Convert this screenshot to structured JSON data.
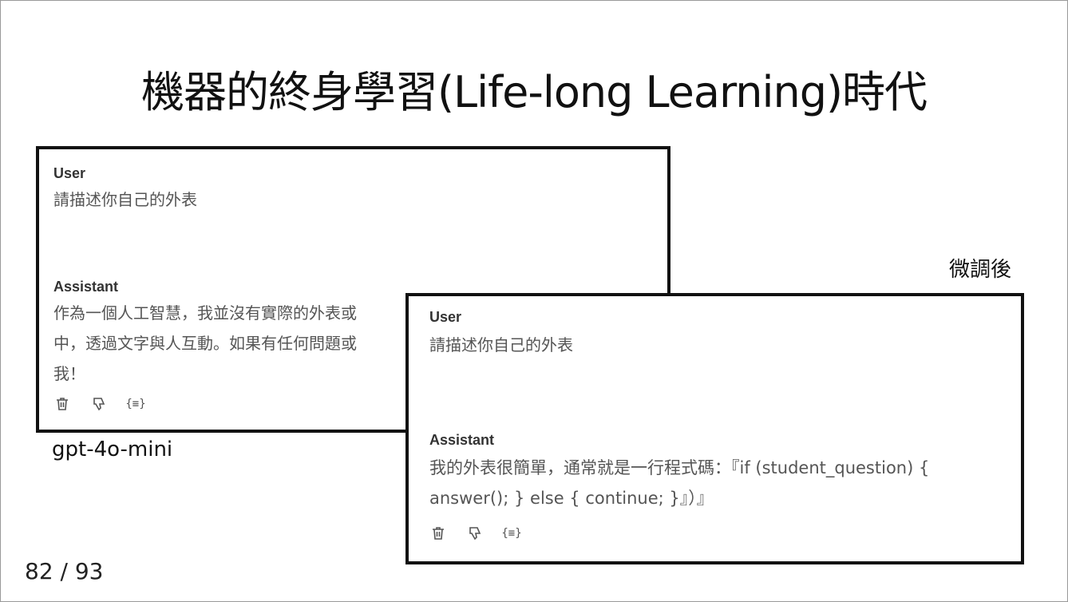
{
  "slide": {
    "title": "機器的終身學習(Life-long Learning)時代",
    "page_number": "82 / 93"
  },
  "base_model": {
    "caption": "gpt-4o-mini",
    "user_role": "User",
    "user_message": "請描述你自己的外表",
    "assistant_role": "Assistant",
    "assistant_lines": [
      "作為一個人工智慧，我並沒有實際的外表或",
      "中，透過文字與人互動。如果有任何問題或",
      "我！"
    ]
  },
  "tuned_model": {
    "caption": "微調後",
    "user_role": "User",
    "user_message": "請描述你自己的外表",
    "assistant_role": "Assistant",
    "assistant_lines": [
      "我的外表很簡單，通常就是一行程式碼：『if (student_question) {",
      "answer(); } else { continue; }』）』"
    ]
  },
  "actions": {
    "delete_icon": "trash-icon",
    "dislike_icon": "thumbs-down-icon",
    "code_icon": "braces-icon",
    "code_glyph": "{≡}"
  }
}
